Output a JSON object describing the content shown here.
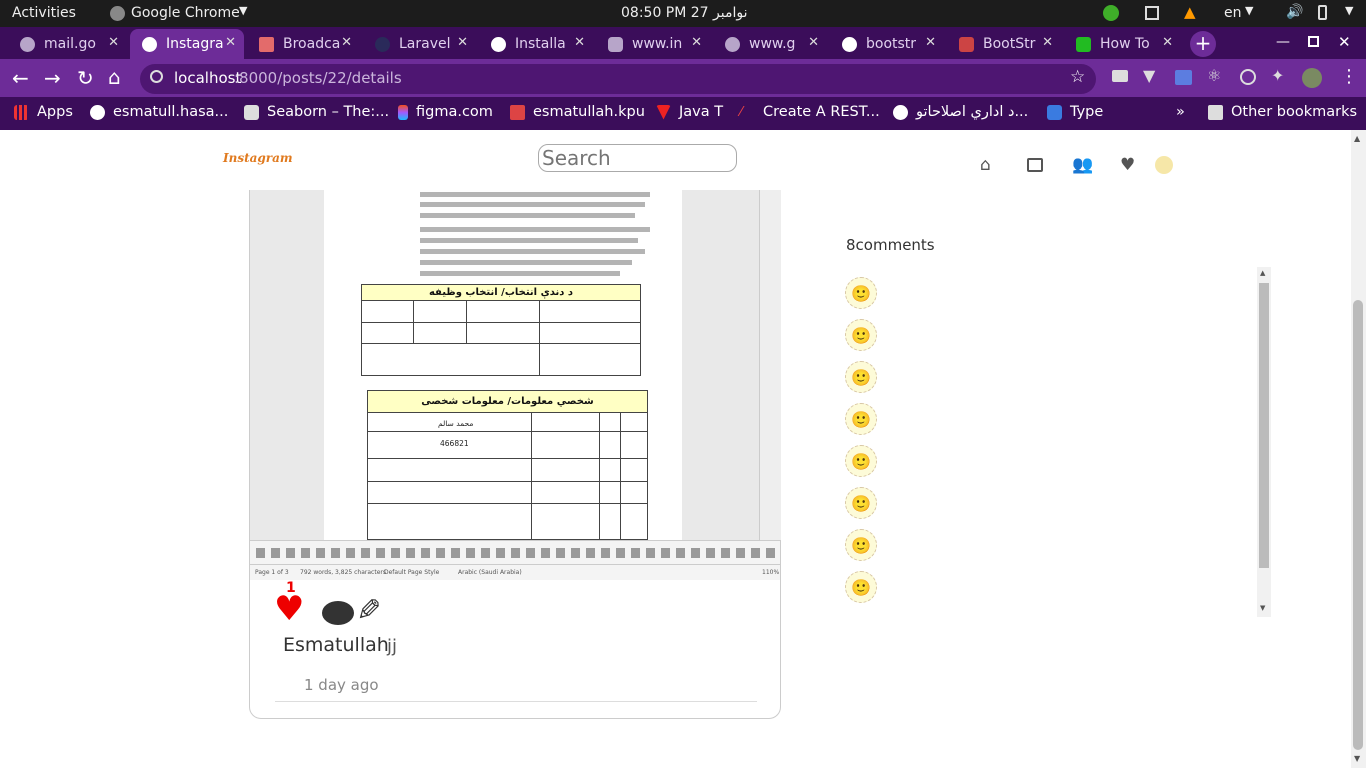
{
  "system_bar": {
    "activities": "Activities",
    "app": "Google Chrome",
    "datetime": "08:50 PM  27 نوامبر",
    "lang": "en"
  },
  "tabs": [
    {
      "label": "mail.go",
      "active": false
    },
    {
      "label": "Instagra",
      "active": true
    },
    {
      "label": "Broadca",
      "active": false
    },
    {
      "label": "Laravel",
      "active": false
    },
    {
      "label": "Installa",
      "active": false
    },
    {
      "label": "www.in",
      "active": false
    },
    {
      "label": "www.g",
      "active": false
    },
    {
      "label": "bootstr",
      "active": false
    },
    {
      "label": "BootStr",
      "active": false
    },
    {
      "label": "How To",
      "active": false
    }
  ],
  "address_bar": {
    "host": "localhost",
    "path": ":8000/posts/22/details"
  },
  "bookmarks": [
    {
      "label": "Apps"
    },
    {
      "label": "esmatull.hasa..."
    },
    {
      "label": "Seaborn – The:..."
    },
    {
      "label": "figma.com"
    },
    {
      "label": "esmatullah.kpu"
    },
    {
      "label": "Java T"
    },
    {
      "label": "Create A REST..."
    },
    {
      "label": "د اداري اصلاحاتو..."
    },
    {
      "label": "Type"
    },
    {
      "label": "»"
    },
    {
      "label": "Other bookmarks"
    }
  ],
  "site": {
    "logo": "Instagram",
    "search_placeholder": "Search"
  },
  "post": {
    "like_count": "1",
    "author": "Esmatullah",
    "caption": "jj",
    "time_ago": "1 day ago"
  },
  "comments": {
    "heading": "8comments",
    "count": 8
  },
  "document": {
    "table1_title": "د دندې انتخاب/ انتخاب وظیفه",
    "table2_title": "شخصي معلومات/ معلومات شخصی",
    "status_page": "Page 1 of 3",
    "status_words": "792 words, 3,825 characters",
    "status_style": "Default Page Style",
    "status_lang": "Arabic (Saudi Arabia)",
    "status_zoom": "110%",
    "value_id": "466821",
    "value_father": "محمد سالم"
  }
}
